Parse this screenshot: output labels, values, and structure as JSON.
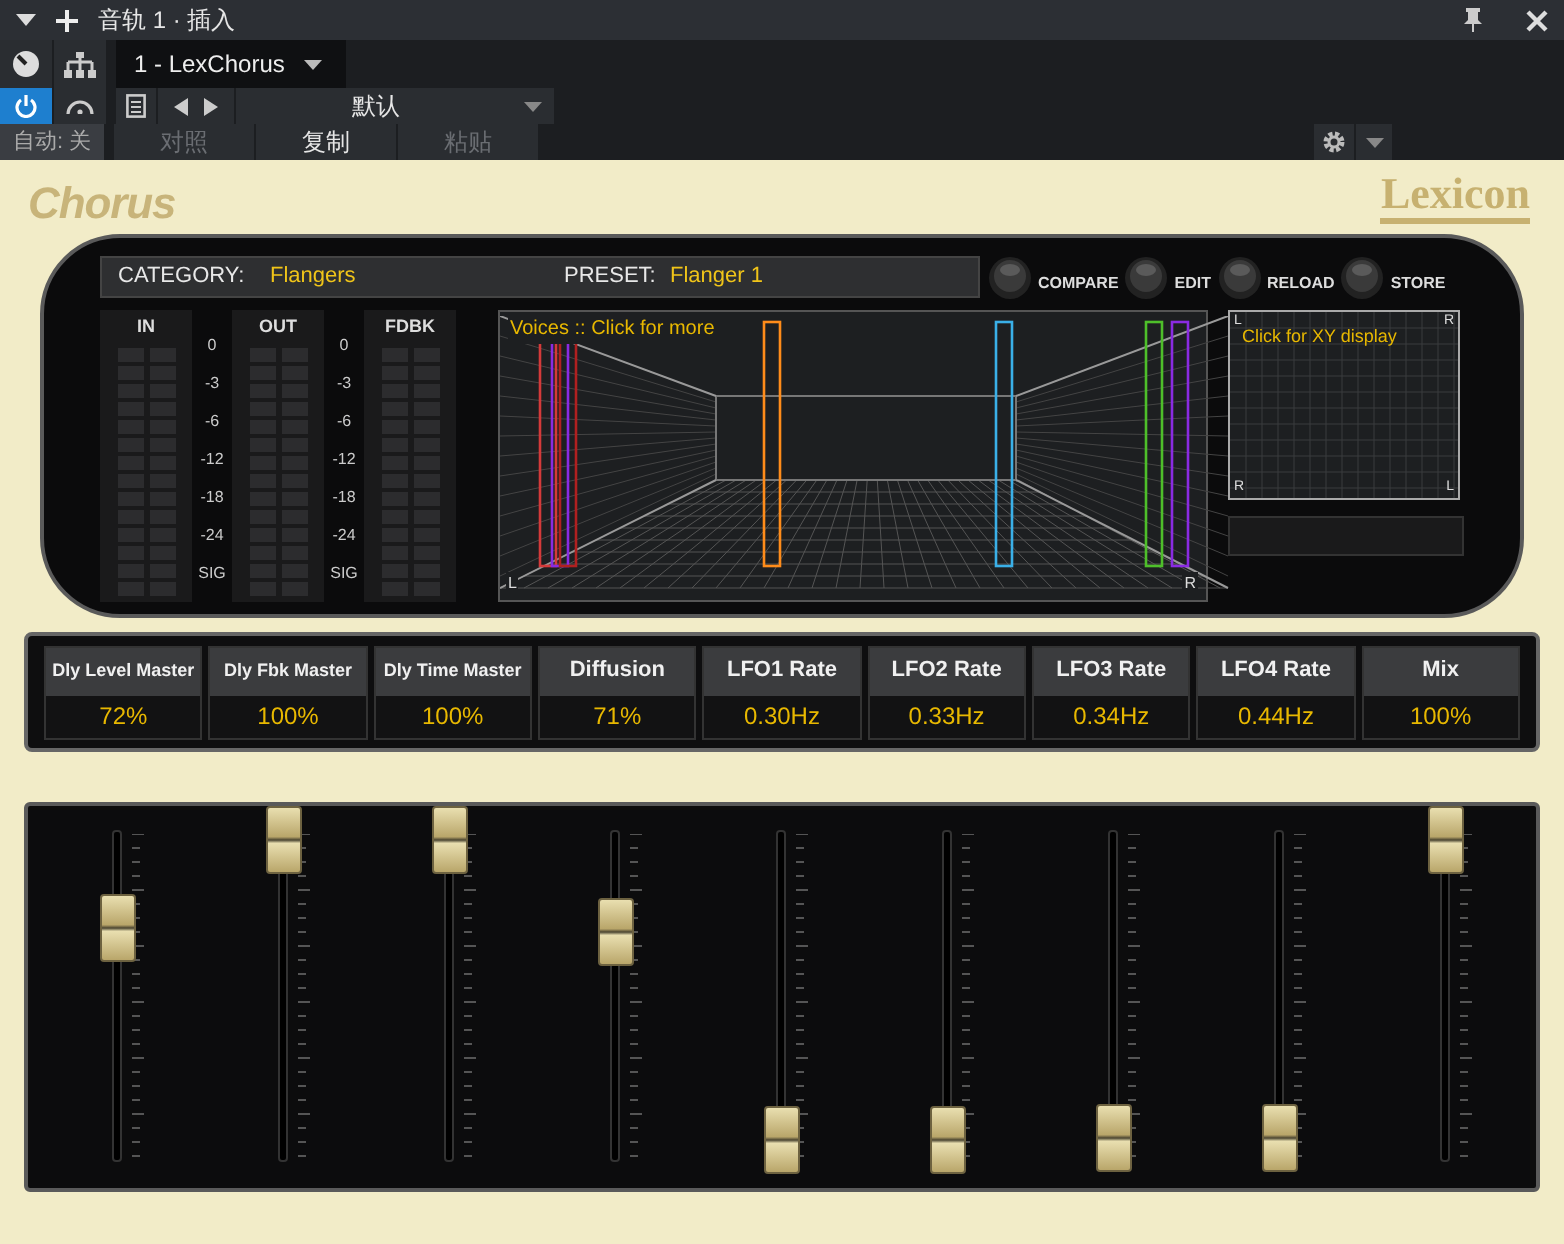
{
  "window": {
    "title": "音轨 1 · 插入"
  },
  "toolbar": {
    "plugin": "1 - LexChorus",
    "preset": "默认",
    "automation": "自动: 关",
    "power_on": true,
    "buttons": [
      {
        "label": "对照",
        "disabled": true
      },
      {
        "label": "复制",
        "disabled": false
      },
      {
        "label": "粘贴",
        "disabled": true
      }
    ]
  },
  "plugin": {
    "title": "Chorus",
    "brand": "Lexicon",
    "category_label": "CATEGORY:",
    "category": "Flangers",
    "preset_label": "PRESET:",
    "preset": "Flanger 1",
    "actions": [
      "COMPARE",
      "EDIT",
      "RELOAD",
      "STORE"
    ],
    "meters": [
      "IN",
      "OUT",
      "FDBK"
    ],
    "scales": [
      [
        "0",
        "-3",
        "-6",
        "-12",
        "-18",
        "-24",
        "SIG"
      ],
      [
        "0",
        "-3",
        "-6",
        "-12",
        "-18",
        "-24",
        "SIG"
      ]
    ],
    "voices": {
      "label": "Voices :: Click for more",
      "left": "L",
      "right": "R"
    },
    "xy": {
      "hint": "Click for XY display",
      "corners": [
        "L",
        "R",
        "R",
        "L"
      ]
    }
  },
  "params": [
    {
      "name": "Dly Level Master",
      "value": "72%",
      "level": 0.72
    },
    {
      "name": "Dly Fbk Master",
      "value": "100%",
      "level": 1
    },
    {
      "name": "Dly Time Master",
      "value": "100%",
      "level": 1
    },
    {
      "name": "Diffusion",
      "value": "71%",
      "level": 0.71
    },
    {
      "name": "LFO1 Rate",
      "value": "0.30Hz",
      "level": 0.05
    },
    {
      "name": "LFO2 Rate",
      "value": "0.33Hz",
      "level": 0.05
    },
    {
      "name": "LFO3 Rate",
      "value": "0.34Hz",
      "level": 0.06
    },
    {
      "name": "LFO4 Rate",
      "value": "0.44Hz",
      "level": 0.06
    },
    {
      "name": "Mix",
      "value": "100%",
      "level": 1
    }
  ]
}
